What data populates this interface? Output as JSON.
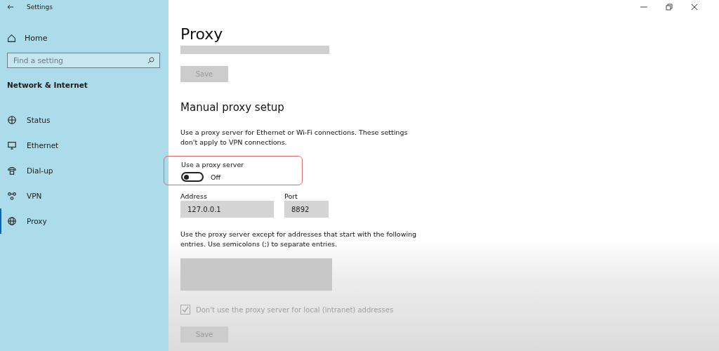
{
  "window": {
    "title": "Settings"
  },
  "sidebar": {
    "home": "Home",
    "search": {
      "placeholder": "Find a setting"
    },
    "section": "Network & Internet",
    "items": [
      {
        "label": "Status",
        "kind": "status",
        "selected": false
      },
      {
        "label": "Ethernet",
        "kind": "ethernet",
        "selected": false
      },
      {
        "label": "Dial-up",
        "kind": "dialup",
        "selected": false
      },
      {
        "label": "VPN",
        "kind": "vpn",
        "selected": false
      },
      {
        "label": "Proxy",
        "kind": "proxy",
        "selected": true
      }
    ]
  },
  "main": {
    "title": "Proxy",
    "top_save": {
      "label": "Save",
      "disabled": true
    },
    "section": "Manual proxy setup",
    "description": "Use a proxy server for Ethernet or Wi-Fi connections. These settings don't apply to VPN connections.",
    "proxy_toggle": {
      "label": "Use a proxy server",
      "on": false,
      "state_text": "Off",
      "highlighted": true
    },
    "address": {
      "label": "Address",
      "value": "127.0.0.1"
    },
    "port": {
      "label": "Port",
      "value": "8892"
    },
    "exceptions_text": "Use the proxy server except for addresses that start with the following entries. Use semicolons (;) to separate entries.",
    "local_checkbox": {
      "label": "Don't use the proxy server for local (intranet) addresses",
      "checked": true,
      "disabled": true
    },
    "bottom_save": {
      "label": "Save",
      "disabled": true
    }
  }
}
